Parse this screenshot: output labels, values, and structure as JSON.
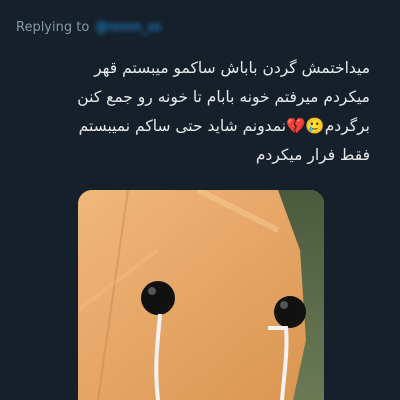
{
  "reply": {
    "label": "Replying to",
    "handle": "@nnnn_ss"
  },
  "tweet": {
    "lines": [
      "میداختمش گردن باباش ساکمو میبستم قهر",
      "میکردم میرفتم خونه بابام تا خونه رو جمع کنن",
      "برگردم🥲💔نمدونم شاید حتی ساکم نمیبستم",
      "فقط فرار میکردم"
    ]
  },
  "media": {
    "description_icon": "wooden-face-earphones-image"
  },
  "colors": {
    "background": "#15202b",
    "text": "#e7e9ea",
    "muted": "#8899a6",
    "accent": "#1d9bf0"
  }
}
